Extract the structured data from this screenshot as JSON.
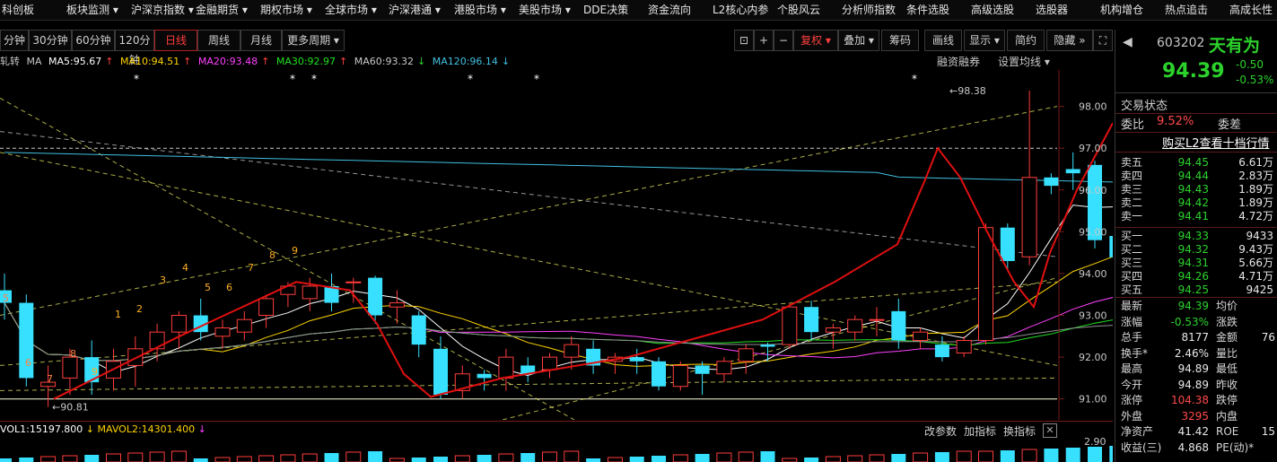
{
  "menu": [
    "科创板",
    "板块监测",
    "沪深京指数",
    "金融期货",
    "期权市场",
    "全球市场",
    "沪深港通",
    "港股市场",
    "美股市场",
    "DDE决策",
    "资金流向",
    "L2核心内参",
    "个股风云",
    "分析师指数",
    "条件选股",
    "高级选股",
    "选股器",
    "机构增仓",
    "热点追击",
    "高成长性"
  ],
  "periods": [
    "分钟",
    "30分钟",
    "60分钟",
    "120分钟",
    "日线",
    "周线",
    "月线",
    "更多周期"
  ],
  "active_period": "日线",
  "tools": {
    "fq": "复权",
    "overlay": "叠加",
    "chip": "筹码",
    "draw": "画线",
    "display": "显示",
    "simple": "简约",
    "hide": "隐藏"
  },
  "ma": {
    "prefix": "轧转",
    "ma_label": "MA",
    "ma5": "MA5:95.67",
    "ma10": "MA10:94.51",
    "ma20": "MA20:93.48",
    "ma30": "MA30:92.97",
    "ma60": "MA60:93.32",
    "ma120": "MA120:96.14",
    "margin": "融资融券",
    "set_ma": "设置均线",
    "colors": {
      "ma5": "#ffffff",
      "ma10": "#ffd400",
      "ma20": "#ff40ff",
      "ma30": "#20e020",
      "ma60": "#909090",
      "ma120": "#40c0e0"
    }
  },
  "price_axis": [
    "98.00",
    "97.00",
    "96.00",
    "95.00",
    "94.00",
    "93.00",
    "92.00",
    "91.00"
  ],
  "annotations": {
    "high": "98.38",
    "low": "90.81"
  },
  "td_counts": [
    "5",
    "6",
    "7",
    "8",
    "9",
    "1",
    "2",
    "3",
    "4",
    "5",
    "6",
    "7",
    "8",
    "9"
  ],
  "volume": {
    "vol1": "VOL1:15197.800",
    "mavol2": "MAVOL2:14301.400",
    "axis": "2.90",
    "btn_param": "改参数",
    "btn_ind": "加指标",
    "btn_switch": "换指标"
  },
  "chart_data": {
    "type": "candlestick",
    "ylim": [
      90.5,
      98.7
    ],
    "candles": [
      {
        "o": 93.6,
        "h": 94.0,
        "c": 93.3,
        "l": 92.9
      },
      {
        "o": 93.3,
        "h": 93.5,
        "c": 91.5,
        "l": 91.3
      },
      {
        "o": 91.3,
        "h": 91.8,
        "c": 91.4,
        "l": 90.81
      },
      {
        "o": 91.5,
        "h": 92.2,
        "c": 92.0,
        "l": 91.1
      },
      {
        "o": 92.0,
        "h": 92.4,
        "c": 91.4,
        "l": 91.1
      },
      {
        "o": 91.5,
        "h": 92.2,
        "c": 91.9,
        "l": 91.2
      },
      {
        "o": 91.8,
        "h": 92.5,
        "c": 92.2,
        "l": 91.3
      },
      {
        "o": 92.2,
        "h": 92.8,
        "c": 92.6,
        "l": 91.9
      },
      {
        "o": 92.6,
        "h": 93.1,
        "c": 93.0,
        "l": 92.2
      },
      {
        "o": 93.0,
        "h": 93.4,
        "c": 92.6,
        "l": 92.4
      },
      {
        "o": 92.5,
        "h": 92.9,
        "c": 92.7,
        "l": 92.2
      },
      {
        "o": 92.6,
        "h": 93.1,
        "c": 92.9,
        "l": 92.4
      },
      {
        "o": 93.0,
        "h": 93.5,
        "c": 93.4,
        "l": 92.7
      },
      {
        "o": 93.5,
        "h": 93.8,
        "c": 93.7,
        "l": 93.2
      },
      {
        "o": 93.4,
        "h": 93.9,
        "c": 93.7,
        "l": 93.1
      },
      {
        "o": 93.7,
        "h": 94.0,
        "c": 93.3,
        "l": 93.1
      },
      {
        "o": 93.8,
        "h": 93.9,
        "c": 93.8,
        "l": 93.3
      },
      {
        "o": 93.9,
        "h": 93.95,
        "c": 93.0,
        "l": 92.8
      },
      {
        "o": 93.2,
        "h": 93.6,
        "c": 93.3,
        "l": 92.8
      },
      {
        "o": 93.0,
        "h": 93.1,
        "c": 92.3,
        "l": 92.0
      },
      {
        "o": 92.2,
        "h": 92.5,
        "c": 91.1,
        "l": 91.0
      },
      {
        "o": 91.2,
        "h": 91.8,
        "c": 91.6,
        "l": 91.0
      },
      {
        "o": 91.6,
        "h": 91.7,
        "c": 91.5,
        "l": 91.2
      },
      {
        "o": 91.5,
        "h": 92.2,
        "c": 92.0,
        "l": 91.2
      },
      {
        "o": 91.8,
        "h": 92.0,
        "c": 91.6,
        "l": 91.4
      },
      {
        "o": 91.7,
        "h": 92.1,
        "c": 92.0,
        "l": 91.5
      },
      {
        "o": 92.0,
        "h": 92.5,
        "c": 92.3,
        "l": 91.7
      },
      {
        "o": 92.2,
        "h": 92.4,
        "c": 91.8,
        "l": 91.6
      },
      {
        "o": 91.9,
        "h": 92.1,
        "c": 92.0,
        "l": 91.6
      },
      {
        "o": 92.0,
        "h": 92.2,
        "c": 91.9,
        "l": 91.6
      },
      {
        "o": 91.9,
        "h": 92.0,
        "c": 91.3,
        "l": 91.2
      },
      {
        "o": 91.3,
        "h": 91.9,
        "c": 91.8,
        "l": 91.2
      },
      {
        "o": 91.8,
        "h": 91.9,
        "c": 91.6,
        "l": 91.1
      },
      {
        "o": 91.6,
        "h": 92.0,
        "c": 91.9,
        "l": 91.4
      },
      {
        "o": 91.9,
        "h": 92.3,
        "c": 92.2,
        "l": 91.6
      },
      {
        "o": 92.3,
        "h": 92.35,
        "c": 92.25,
        "l": 91.9
      },
      {
        "o": 92.3,
        "h": 93.3,
        "c": 93.2,
        "l": 92.2
      },
      {
        "o": 93.2,
        "h": 93.35,
        "c": 92.6,
        "l": 92.4
      },
      {
        "o": 92.6,
        "h": 92.8,
        "c": 92.7,
        "l": 92.2
      },
      {
        "o": 92.6,
        "h": 93.0,
        "c": 92.9,
        "l": 92.4
      },
      {
        "o": 92.9,
        "h": 93.2,
        "c": 92.9,
        "l": 92.5
      },
      {
        "o": 93.1,
        "h": 93.4,
        "c": 92.4,
        "l": 92.2
      },
      {
        "o": 92.4,
        "h": 92.7,
        "c": 92.6,
        "l": 92.2
      },
      {
        "o": 92.3,
        "h": 92.5,
        "c": 92.0,
        "l": 91.9
      },
      {
        "o": 92.1,
        "h": 92.5,
        "c": 92.4,
        "l": 92.0
      },
      {
        "o": 92.4,
        "h": 95.2,
        "c": 95.1,
        "l": 92.3
      },
      {
        "o": 95.1,
        "h": 95.2,
        "c": 94.3,
        "l": 94.1
      },
      {
        "o": 94.4,
        "h": 98.38,
        "c": 96.3,
        "l": 94.2
      },
      {
        "o": 96.3,
        "h": 96.4,
        "c": 96.1,
        "l": 95.9
      },
      {
        "o": 96.5,
        "h": 96.9,
        "c": 96.4,
        "l": 96.0
      },
      {
        "o": 96.6,
        "h": 96.7,
        "c": 94.8,
        "l": 94.6
      },
      {
        "o": 94.9,
        "h": 95.0,
        "c": 94.39,
        "l": 93.2
      }
    ]
  },
  "quote": {
    "code": "603202",
    "name": "天有为",
    "price": "94.39",
    "change": "-0.50",
    "pct": "-0.53%",
    "status": "交易状态",
    "wb_label": "委比",
    "wb_value": "9.52%",
    "wc_label": "委差",
    "l2": "购买L2查看十档行情",
    "asks": [
      {
        "k": "卖五",
        "p": "94.45",
        "v": "6.61万"
      },
      {
        "k": "卖四",
        "p": "94.44",
        "v": "2.83万"
      },
      {
        "k": "卖三",
        "p": "94.43",
        "v": "1.89万"
      },
      {
        "k": "卖二",
        "p": "94.42",
        "v": "1.89万"
      },
      {
        "k": "卖一",
        "p": "94.41",
        "v": "4.72万"
      }
    ],
    "bids": [
      {
        "k": "买一",
        "p": "94.33",
        "v": "9433"
      },
      {
        "k": "买二",
        "p": "94.32",
        "v": "9.43万"
      },
      {
        "k": "买三",
        "p": "94.31",
        "v": "5.66万"
      },
      {
        "k": "买四",
        "p": "94.26",
        "v": "4.71万"
      },
      {
        "k": "买五",
        "p": "94.25",
        "v": "9425"
      }
    ],
    "stats": [
      {
        "k": "最新",
        "v": "94.39",
        "c": "green",
        "k2": "均价",
        "v2": ""
      },
      {
        "k": "涨幅",
        "v": "-0.53%",
        "c": "green",
        "k2": "涨跌",
        "v2": ""
      },
      {
        "k": "总手",
        "v": "8177",
        "c": "white",
        "k2": "金额",
        "v2": "76"
      },
      {
        "k": "换手*",
        "v": "2.46%",
        "c": "white",
        "k2": "量比",
        "v2": ""
      },
      {
        "k": "最高",
        "v": "94.89",
        "c": "white",
        "k2": "最低",
        "v2": ""
      },
      {
        "k": "今开",
        "v": "94.89",
        "c": "white",
        "k2": "昨收",
        "v2": ""
      },
      {
        "k": "涨停",
        "v": "104.38",
        "c": "red",
        "k2": "跌停",
        "v2": ""
      },
      {
        "k": "外盘",
        "v": "3295",
        "c": "red",
        "k2": "内盘",
        "v2": ""
      },
      {
        "k": "净资产",
        "v": "41.42",
        "c": "white",
        "k2": "ROE",
        "v2": "15"
      },
      {
        "k": "收益(三)",
        "v": "4.868",
        "c": "white",
        "k2": "PE(动)*",
        "v2": ""
      }
    ]
  }
}
